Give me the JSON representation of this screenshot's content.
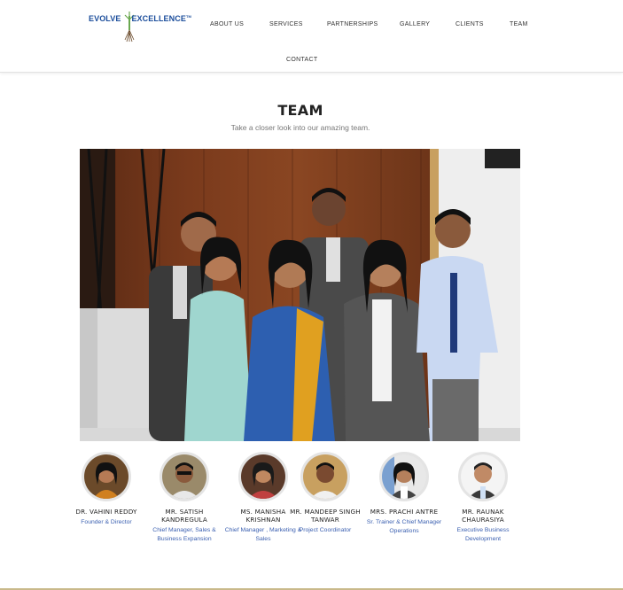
{
  "brand": {
    "name_part1": "EVOLVE",
    "name_part2": "EXCELLENCE",
    "trademark": "TM",
    "colors": {
      "primary": "#1b4d9b",
      "accent": "#6aa84f"
    }
  },
  "nav": {
    "about": "ABOUT US",
    "services": "SERVICES",
    "partnerships": "PARTNERSHIPS",
    "gallery": "GALLERY",
    "clients": "CLIENTS",
    "team": "TEAM",
    "contact": "CONTACT"
  },
  "section": {
    "title": "TEAM",
    "subtitle": "Take a closer look into our amazing team."
  },
  "members": [
    {
      "name": "DR. VAHINI REDDY",
      "role": "Founder & Director"
    },
    {
      "name": "MR. SATISH KANDREGULA",
      "role": "Chief Manager, Sales & Business Expansion"
    },
    {
      "name": "MS. MANISHA KRISHNAN",
      "role": "Chief Manager , Marketing & Sales"
    },
    {
      "name": "MR. MANDEEP SINGH TANWAR",
      "role": "Project Coordinator"
    },
    {
      "name": "MRS. PRACHI ANTRE",
      "role": "Sr. Trainer & Chief Manager Operations"
    },
    {
      "name": "MR. RAUNAK CHAURASIYA",
      "role": "Executive Business Development"
    }
  ]
}
